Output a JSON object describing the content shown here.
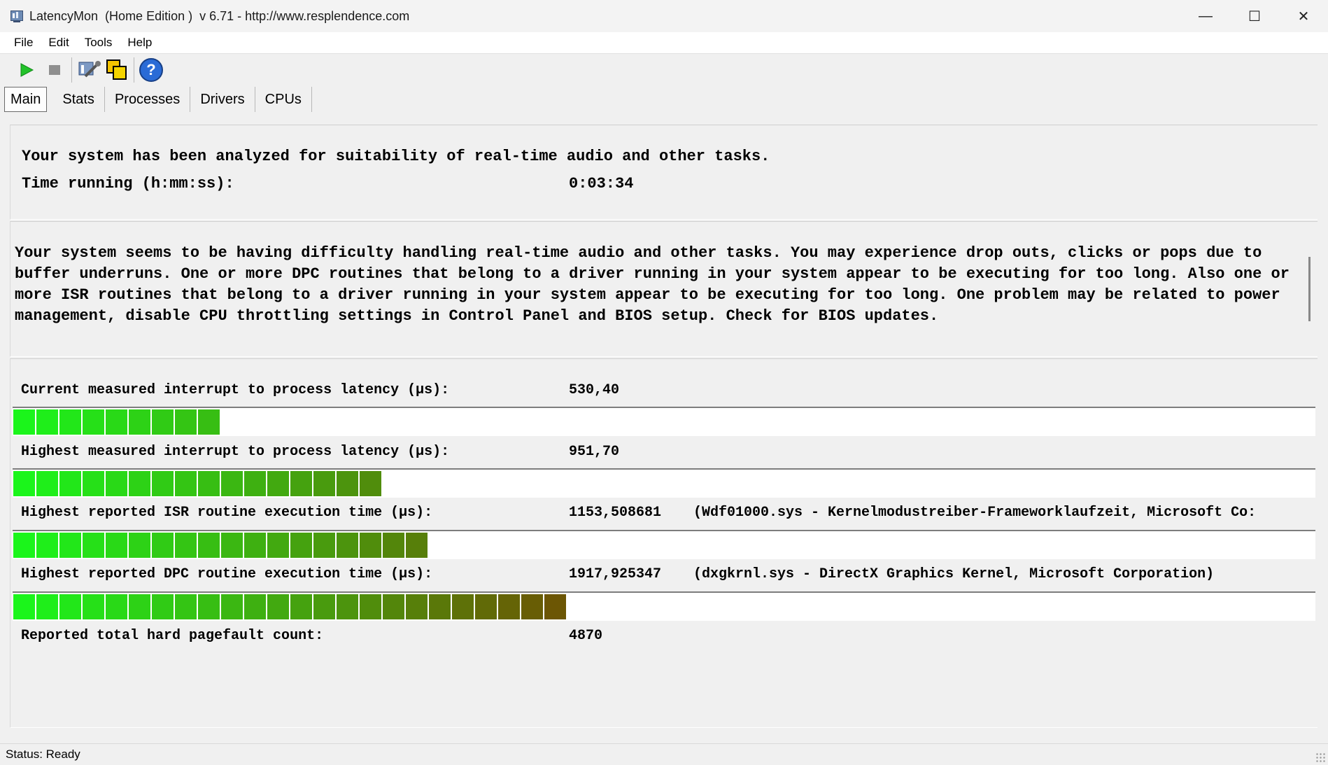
{
  "window": {
    "title": "LatencyMon  (Home Edition )  v 6.71 - http://www.resplendence.com",
    "minimize": "—",
    "maximize": "☐",
    "close": "✕"
  },
  "menu": [
    "File",
    "Edit",
    "Tools",
    "Help"
  ],
  "toolbar": {
    "icons": [
      "play-icon",
      "stop-icon",
      "tools-icon",
      "windows-icon",
      "help-icon"
    ],
    "help_glyph": "?"
  },
  "tabs": [
    "Main",
    "Stats",
    "Processes",
    "Drivers",
    "CPUs"
  ],
  "summary": {
    "line1": "Your system has been analyzed for suitability of real-time audio and other tasks.",
    "time_label": "Time running (h:mm:ss):",
    "time_value": "0:03:34"
  },
  "message": "Your system seems to be having difficulty handling real-time audio and other tasks. You may experience drop outs, clicks or pops due to buffer underruns. One or more DPC routines that belong to a driver running in your system appear to be executing for too long. Also one or more ISR routines that belong to a driver running in your system appear to be executing for too long. One problem may be related to power management, disable CPU throttling settings in Control Panel and BIOS setup. Check for BIOS updates.",
  "metrics": [
    {
      "label": "Current measured interrupt to process latency (µs):",
      "value": "530,40",
      "extra": "",
      "segments": 9
    },
    {
      "label": "Highest measured interrupt to process latency (µs):",
      "value": "951,70",
      "extra": "",
      "segments": 16
    },
    {
      "label": "Highest reported ISR routine execution time (µs):",
      "value": "1153,508681",
      "extra": "(Wdf01000.sys - Kernelmodustreiber-Frameworklaufzeit, Microsoft Co:",
      "segments": 18
    },
    {
      "label": "Highest reported DPC routine execution time (µs):",
      "value": "1917,925347",
      "extra": "(dxgkrnl.sys - DirectX Graphics Kernel, Microsoft Corporation)",
      "segments": 24
    },
    {
      "label": "Reported total hard pagefault count:",
      "value": "4870",
      "extra": "",
      "segments": 0
    }
  ],
  "status": "Status: Ready",
  "colors": {
    "bar_start": "#1bf51b",
    "bar_end": "#7a3a00"
  }
}
